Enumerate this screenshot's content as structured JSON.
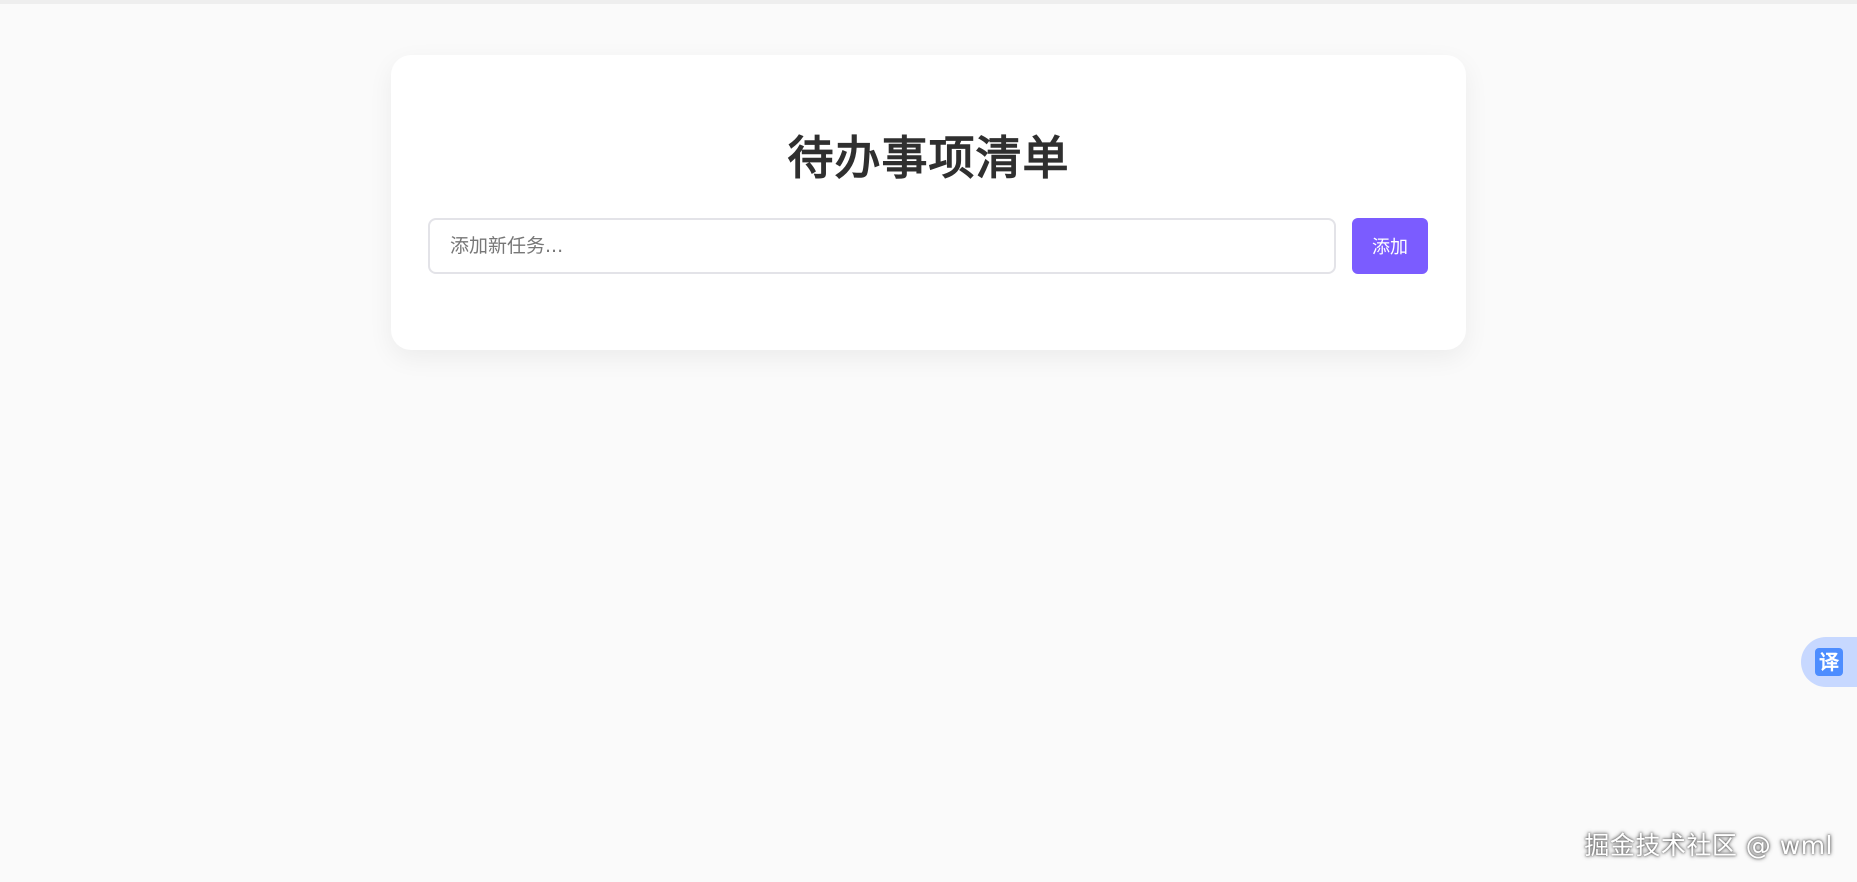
{
  "app": {
    "title": "待办事项清单"
  },
  "input": {
    "placeholder": "添加新任务...",
    "value": ""
  },
  "buttons": {
    "add_label": "添加"
  },
  "floating": {
    "translate_label": "译"
  },
  "watermark": {
    "text": "掘金技术社区 @ wml"
  },
  "colors": {
    "accent": "#7b5cff",
    "background": "#fafafa",
    "card": "#ffffff",
    "title": "#2f2f2f"
  }
}
